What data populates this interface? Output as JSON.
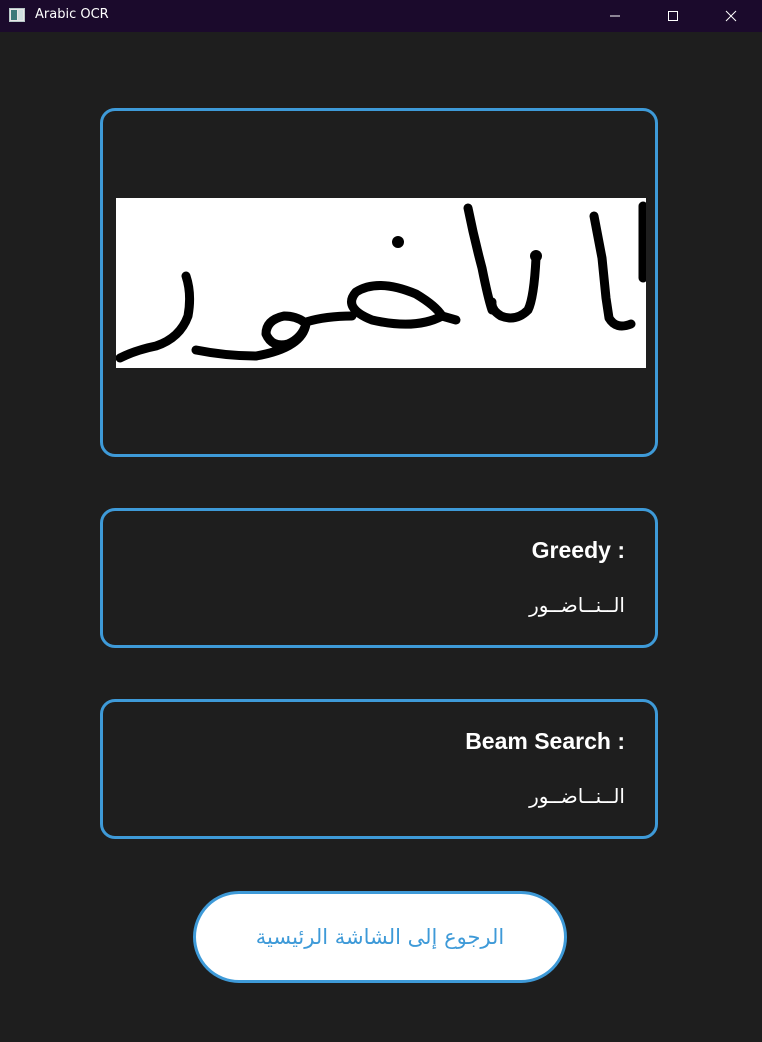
{
  "window": {
    "title": "Arabic OCR"
  },
  "input_image": {
    "description_icon": "handwritten-word-image"
  },
  "results": {
    "greedy": {
      "label": "Greedy :",
      "value": "الــنــاضــور"
    },
    "beam": {
      "label": "Beam Search :",
      "value": "الــنــاضــور"
    }
  },
  "back_button": {
    "label": "الرجوع إلى الشاشة الرئيسية"
  },
  "colors": {
    "accent": "#3e9ad8",
    "background": "#1e1e1e",
    "titlebar": "#1b0a2c",
    "text": "#ffffff"
  }
}
